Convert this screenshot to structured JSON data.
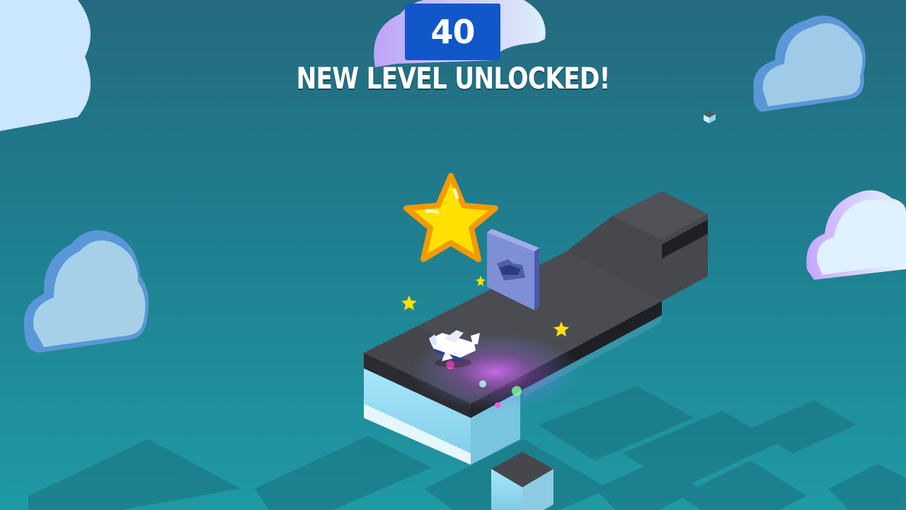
{
  "hud": {
    "score": "40",
    "banner": "NEW LEVEL UNLOCKED!"
  },
  "colors": {
    "sky_top": "#256a80",
    "sky_bottom": "#1f9aa4",
    "score_box": "#1257c9",
    "platform_top": "#45474d",
    "platform_side": "#9fe0f5",
    "star": "#ffe000",
    "star_outline": "#f39a00"
  },
  "icons": {
    "reward": "star-icon",
    "player": "airplane-icon",
    "goal": "hangar-gate-icon"
  }
}
